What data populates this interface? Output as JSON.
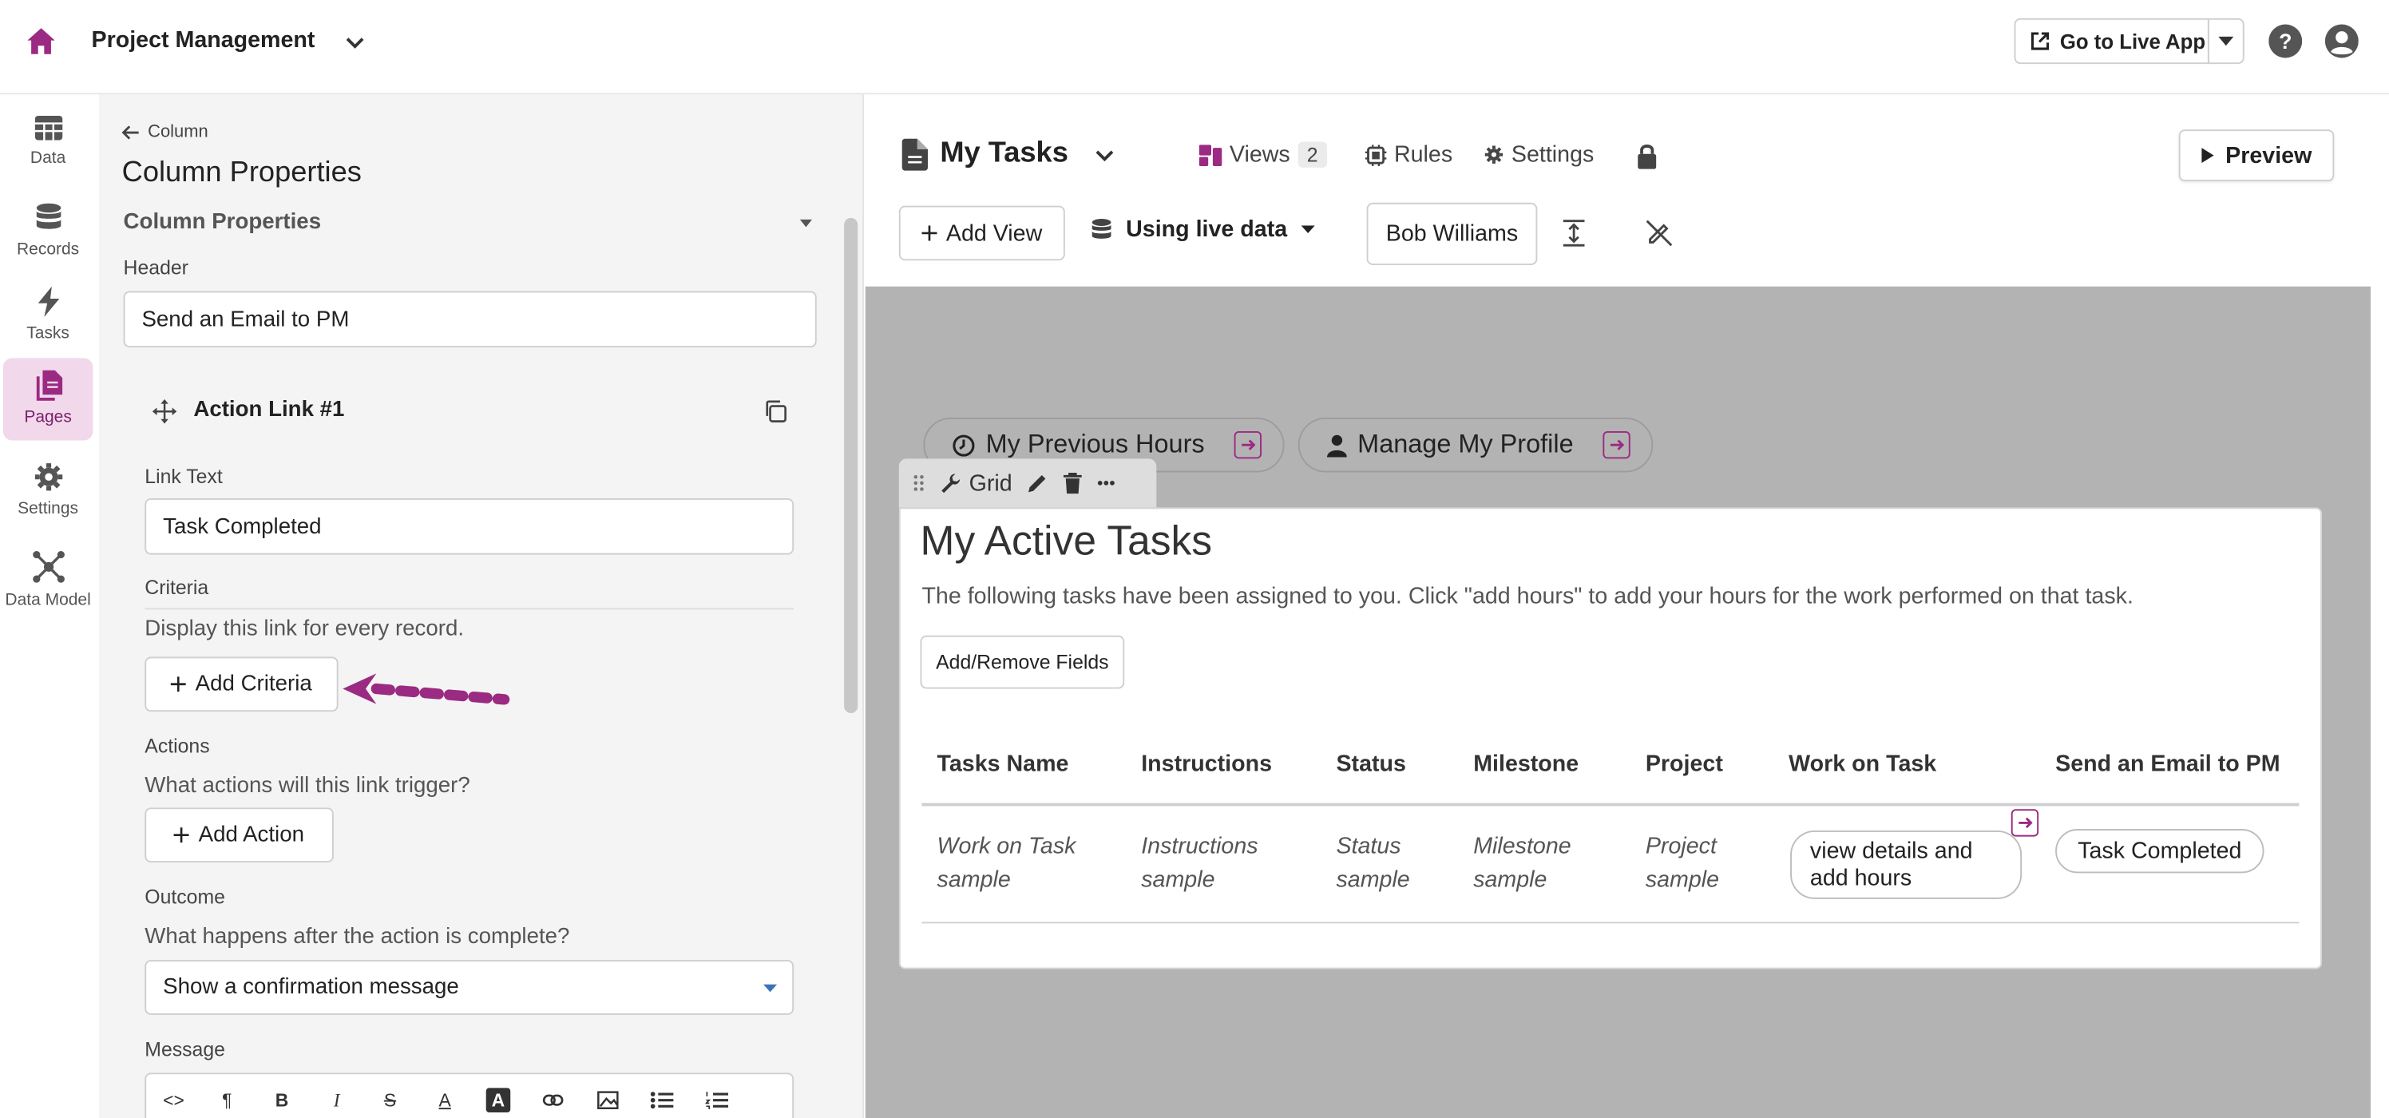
{
  "header": {
    "app_title": "Project Management",
    "live_app_label": "Go to Live App"
  },
  "nav": {
    "items": [
      {
        "label": "Data",
        "icon": "table-icon"
      },
      {
        "label": "Records",
        "icon": "database-icon"
      },
      {
        "label": "Tasks",
        "icon": "bolt-icon"
      },
      {
        "label": "Pages",
        "icon": "pages-icon",
        "active": true
      },
      {
        "label": "Settings",
        "icon": "gear-icon"
      },
      {
        "label": "Data Model",
        "icon": "data-model-icon"
      }
    ]
  },
  "panel": {
    "breadcrumb": "Column",
    "title": "Column Properties",
    "section_title": "Column Properties",
    "header_label": "Header",
    "header_value": "Send an Email to PM",
    "card_title": "Action Link #1",
    "link_text_label": "Link Text",
    "link_text_value": "Task Completed",
    "criteria_label": "Criteria",
    "criteria_desc": "Display this link for every record.",
    "add_criteria": "Add Criteria",
    "actions_label": "Actions",
    "actions_desc": "What actions will this link trigger?",
    "add_action": "Add Action",
    "outcome_label": "Outcome",
    "outcome_desc": "What happens after the action is complete?",
    "outcome_value": "Show a confirmation message",
    "message_label": "Message",
    "toolbar_icons": [
      "code-icon",
      "paragraph-icon",
      "bold-icon",
      "italic-icon",
      "strikethrough-icon",
      "font-color-icon",
      "background-color-icon",
      "link-icon",
      "image-icon",
      "bullet-list-icon",
      "numbered-list-icon"
    ]
  },
  "editor": {
    "view_title": "My Tasks",
    "views_label": "Views",
    "views_count": "2",
    "rules_label": "Rules",
    "settings_label": "Settings",
    "preview_label": "Preview",
    "add_view_label": "Add View",
    "live_data_label": "Using live data",
    "user_label": "Bob Williams"
  },
  "canvas": {
    "menu_links": [
      "My Previous Hours",
      "Manage My Profile"
    ],
    "grid_label": "Grid",
    "card": {
      "title": "My Active Tasks",
      "description": "The following tasks have been assigned to you. Click \"add hours\" to add your hours for the work performed on that task.",
      "add_remove_fields": "Add/Remove Fields",
      "columns": [
        "Tasks Name",
        "Instructions",
        "Status",
        "Milestone",
        "Project",
        "Work on Task",
        "Send an Email to PM"
      ],
      "row": {
        "tasks_name": "Work on Task sample",
        "instructions": "Instructions sample",
        "status": "Status sample",
        "milestone": "Milestone sample",
        "project": "Project sample",
        "work_on_task": "view details and add hours",
        "send_email": "Task Completed"
      }
    }
  },
  "colors": {
    "brand": "#9b2a82",
    "nav_active_bg": "#f1d8eb",
    "canvas_bg": "#b3b3b3",
    "panel_bg": "#f4f4f4"
  }
}
